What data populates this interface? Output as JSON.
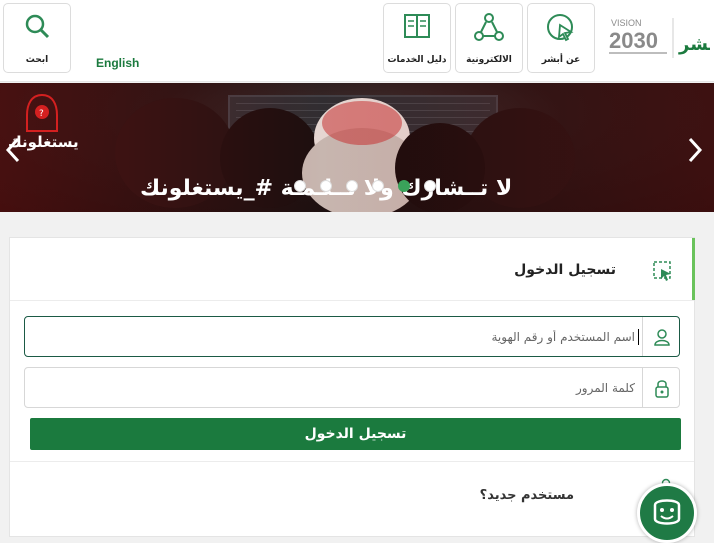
{
  "header": {
    "search_label": "ابحث",
    "language_label": "English",
    "tiles": [
      {
        "label": "دليل الخدمات",
        "icon": "book-icon"
      },
      {
        "label": "الالكترونية",
        "icon": "share-network-icon"
      },
      {
        "label": "عن أبشر",
        "icon": "cursor-click-icon"
      }
    ],
    "logo_vision": "VISION",
    "logo_year": "2030",
    "logo_brand": "أبشر"
  },
  "banner": {
    "headline": "لا تــشارك ولا تــلـمـة #_يستغلونك",
    "brand_text": "يستغلونك",
    "prev_icon": "chevron-left-icon",
    "next_icon": "chevron-right-icon",
    "slide_count": 8,
    "active_slide": 4
  },
  "login": {
    "title": "تسجيل الدخول",
    "username_placeholder": "اسم المستخدم أو رقم الهوية",
    "password_placeholder": "كلمة المرور",
    "submit_label": "تسجيل الدخول",
    "new_user_label": "مستخدم جديد؟"
  },
  "colors": {
    "primary_green": "#1b7a3e",
    "accent_green": "#6ac35c"
  }
}
